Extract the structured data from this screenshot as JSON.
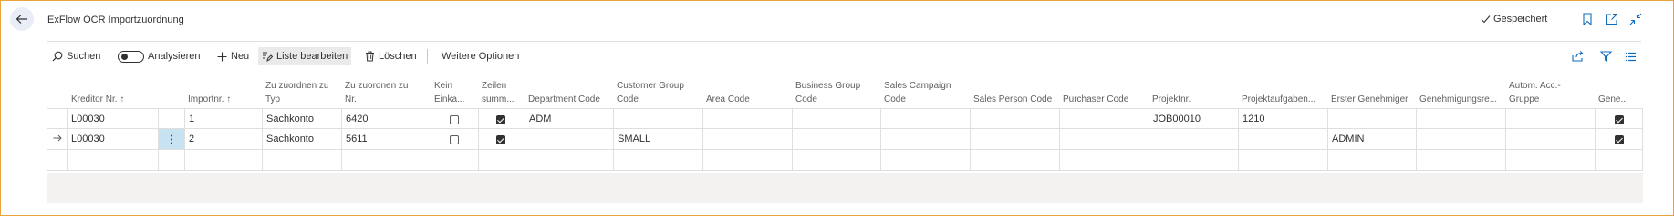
{
  "header": {
    "title": "ExFlow OCR Importzuordnung",
    "saved_label": "Gespeichert"
  },
  "toolbar": {
    "search_label": "Suchen",
    "analyze_label": "Analysieren",
    "new_label": "Neu",
    "edit_list_label": "Liste bearbeiten",
    "delete_label": "Löschen",
    "more_options_label": "Weitere Optionen"
  },
  "table": {
    "columns": {
      "kreditor": "Kreditor Nr. ↑",
      "importnr": "Importnr. ↑",
      "typ_1": "Zu zuordnen zu",
      "typ_2": "Typ",
      "nr_1": "Zu zuordnen zu",
      "nr_2": "Nr.",
      "kein_1": "Kein",
      "kein_2": "Einka...",
      "zeilen_1": "Zeilen",
      "zeilen_2": "summ...",
      "department": "Department Code",
      "customer_1": "Customer Group",
      "customer_2": "Code",
      "area": "Area Code",
      "business_1": "Business Group",
      "business_2": "Code",
      "campaign_1": "Sales Campaign",
      "campaign_2": "Code",
      "salesperson": "Sales Person Code",
      "purchaser": "Purchaser Code",
      "projekt": "Projektnr.",
      "projektaufgabe": "Projektaufgaben...",
      "genehmiger": "Erster Genehmiger",
      "genehmigungsre": "Genehmigungsre...",
      "autom_1": "Autom. Acc.-",
      "autom_2": "Gruppe",
      "gene": "Gene..."
    },
    "rows": [
      {
        "kreditor": "L00030",
        "importnr": "1",
        "typ": "Sachkonto",
        "nr": "6420",
        "kein_einkauf": false,
        "zeilen_summe": true,
        "department": "ADM",
        "customer_group": "",
        "area": "",
        "business_group": "",
        "sales_campaign": "",
        "sales_person": "",
        "purchaser": "",
        "projekt": "JOB00010",
        "projektaufgabe": "1210",
        "genehmiger": "",
        "genehmigungsre": "",
        "autom": "",
        "gene": true
      },
      {
        "kreditor": "L00030",
        "importnr": "2",
        "typ": "Sachkonto",
        "nr": "5611",
        "kein_einkauf": false,
        "zeilen_summe": true,
        "department": "",
        "customer_group": "SMALL",
        "area": "",
        "business_group": "",
        "sales_campaign": "",
        "sales_person": "",
        "purchaser": "",
        "projekt": "",
        "projektaufgabe": "",
        "genehmiger": "ADMIN",
        "genehmigungsre": "",
        "autom": "",
        "gene": true
      }
    ]
  },
  "icons": {
    "back": "arrow-left-icon",
    "saved_check": "check-icon",
    "bookmark": "bookmark-icon",
    "open_new": "open-in-new-window-icon",
    "collapse": "collapse-icon",
    "search": "search-icon",
    "new": "plus-icon",
    "edit_list": "edit-list-icon",
    "delete": "trash-icon",
    "share": "share-icon",
    "filter": "filter-icon",
    "list_view": "list-view-icon",
    "row_arrow": "arrow-right-icon",
    "row_menu": "more-vertical-icon"
  },
  "colors": {
    "accent": "#0f6cbd",
    "frame_border": "#e8a33d",
    "selected_cell": "#c7e3f1"
  }
}
